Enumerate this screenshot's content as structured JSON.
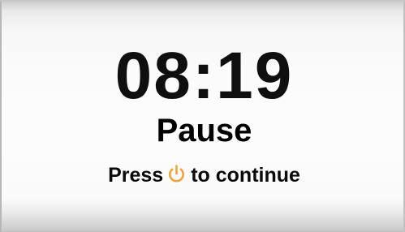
{
  "screen": {
    "timer": "08:19",
    "status": "Pause",
    "hint": {
      "before": "Press",
      "icon": "power-icon",
      "after": "to continue"
    }
  },
  "colors": {
    "text": "#000000",
    "icon_accent": "#f0a23c",
    "frame_gradient_top": "#cfcfcf",
    "frame_gradient_mid": "#fbfbfb",
    "frame_gradient_bottom": "#c9c9c9"
  }
}
